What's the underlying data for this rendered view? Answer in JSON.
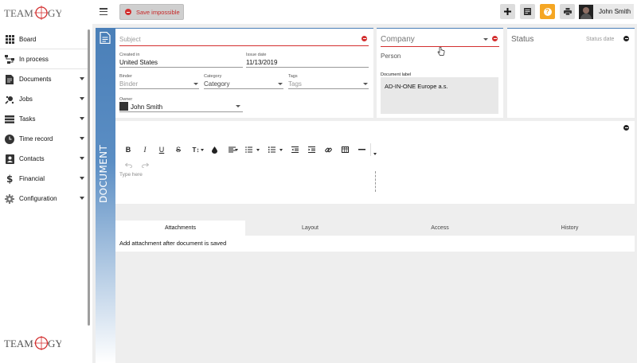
{
  "brand": {
    "logo_text": "TEAMOGY"
  },
  "sidebar": {
    "items": [
      {
        "label": "Board",
        "icon": "grid-icon",
        "caret": false
      },
      {
        "label": "In process",
        "icon": "flow-icon",
        "caret": false
      },
      {
        "label": "Documents",
        "icon": "document-icon",
        "caret": true
      },
      {
        "label": "Jobs",
        "icon": "jobs-icon",
        "caret": true
      },
      {
        "label": "Tasks",
        "icon": "tasks-icon",
        "caret": true
      },
      {
        "label": "Time record",
        "icon": "clock-icon",
        "caret": true
      },
      {
        "label": "Contacts",
        "icon": "contacts-icon",
        "caret": true
      },
      {
        "label": "Financial",
        "icon": "dollar-icon",
        "caret": true
      },
      {
        "label": "Configuration",
        "icon": "gear-icon",
        "caret": true
      }
    ]
  },
  "toolbar": {
    "save_label": "Save impossible",
    "help_glyph": "?",
    "user_name": "John Smith"
  },
  "strip": {
    "label": "DOCUMENT"
  },
  "form": {
    "subject_placeholder": "Subject",
    "created_in_label": "Created in",
    "created_in_value": "United States",
    "issue_date_label": "Issue date",
    "issue_date_value": "11/13/2019",
    "binder_label": "Binder",
    "binder_placeholder": "Binder",
    "category_label": "Category",
    "category_value": "Category",
    "tags_label": "Tags",
    "tags_placeholder": "Tags",
    "owner_label": "Owner",
    "owner_value": "John Smith"
  },
  "company": {
    "placeholder": "Company",
    "person_label": "Person",
    "doc_label_title": "Document label",
    "doc_label_value": "AD-IN-ONE Europe a.s."
  },
  "status": {
    "title": "Status",
    "date_placeholder": "Status date"
  },
  "editor": {
    "placeholder": "Type here",
    "tools": [
      "B",
      "I",
      "U",
      "S",
      "T↕",
      "◆",
      "≡",
      "•≡",
      "≡",
      "⇤",
      "⇥",
      "⛓",
      "▦",
      "—"
    ]
  },
  "tabs": [
    {
      "label": "Attachments",
      "active": true
    },
    {
      "label": "Layout",
      "active": false
    },
    {
      "label": "Access",
      "active": false
    },
    {
      "label": "History",
      "active": false
    }
  ],
  "attachments": {
    "message": "Add attachment after document is saved"
  },
  "colors": {
    "accent": "#4a7fb8",
    "danger": "#d32f2f",
    "help": "#f5a623"
  }
}
